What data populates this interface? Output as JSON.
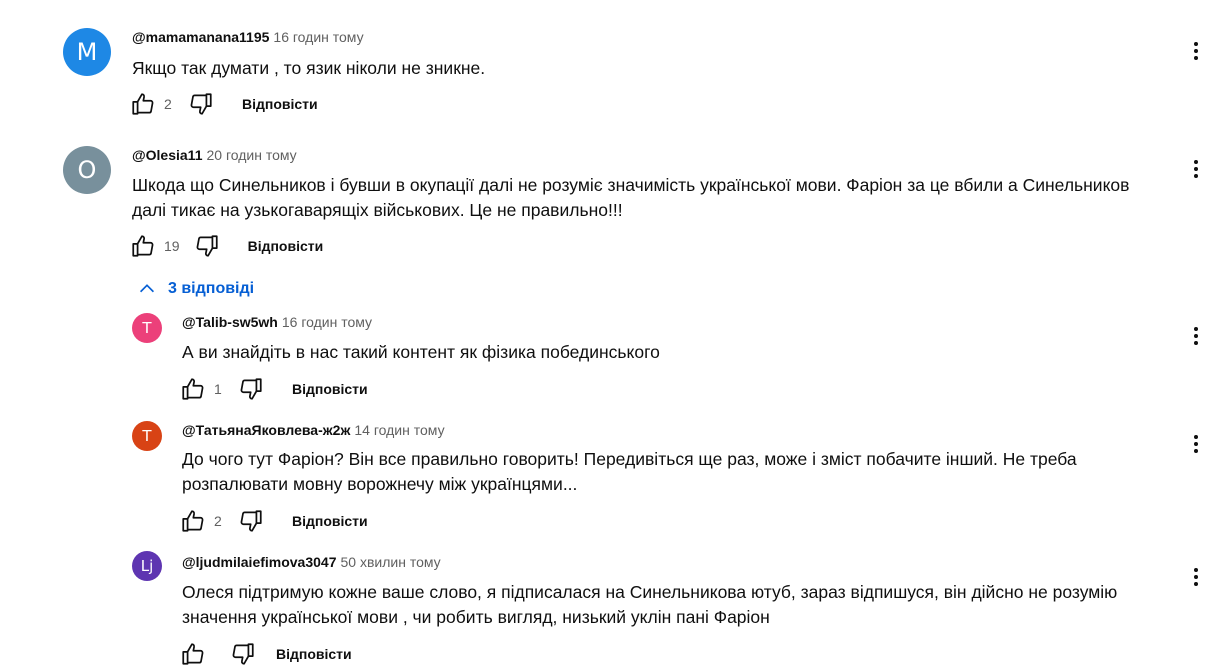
{
  "comments": [
    {
      "author": "@mamamanana1195",
      "time": "16 годин тому",
      "avatar_letter": "M",
      "avatar_color": "#1e88e5",
      "text": "Якщо так думати , то язик ніколи не зникне.",
      "likes": "2",
      "reply_label": "Відповісти"
    },
    {
      "author": "@Olesia11",
      "time": "20 годин тому",
      "avatar_letter": "O",
      "avatar_color": "#78909c",
      "text": "Шкода що Синельников і бувши в окупації далі не розуміє значимість української мови. Фаріон за це вбили а Синельников далі тикає на узькогаварящіх військових. Це не правильно!!!",
      "likes": "19",
      "reply_label": "Відповісти",
      "replies_toggle": "3 відповіді",
      "replies": [
        {
          "author": "@Talib-sw5wh",
          "time": "16 годин тому",
          "avatar_letter": "T",
          "avatar_color": "#ec407a",
          "text": "А ви знайдіть в нас такий контент як фізика побединського",
          "likes": "1",
          "reply_label": "Відповісти"
        },
        {
          "author": "@ТатьянаЯковлева-ж2ж",
          "time": "14 годин тому",
          "avatar_letter": "T",
          "avatar_color": "#d84315",
          "text": "До чого тут Фаріон? Він все правильно говорить! Передивіться ще раз, може і зміст побачите інший. Не треба розпалювати мовну  ворожнечу між українцями...",
          "likes": "2",
          "reply_label": "Відповісти"
        },
        {
          "author": "@ljudmilaiefimova3047",
          "time": "50 хвилин тому",
          "avatar_letter": "Lj",
          "avatar_color": "#5e35b1",
          "text": "Олеся підтримую кожне ваше слово,  я підписалася на Синельникова ютуб,  зараз відпишуся,  він дійсно не розумію значення української мови , чи робить вигляд,  низький уклін пані Фаріон",
          "likes": "",
          "reply_label": "Відповісти"
        }
      ]
    }
  ]
}
